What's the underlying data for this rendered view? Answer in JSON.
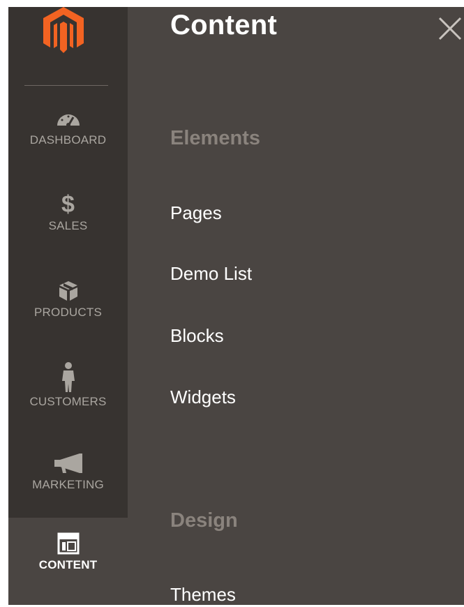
{
  "panel": {
    "title": "Content",
    "close_icon": "close-icon"
  },
  "sidebar": {
    "logo_icon": "magento-logo",
    "items": [
      {
        "label": "DASHBOARD",
        "icon": "speedometer-icon"
      },
      {
        "label": "SALES",
        "icon": "dollar-icon"
      },
      {
        "label": "PRODUCTS",
        "icon": "box-icon"
      },
      {
        "label": "CUSTOMERS",
        "icon": "person-icon"
      },
      {
        "label": "MARKETING",
        "icon": "megaphone-icon"
      },
      {
        "label": "CONTENT",
        "icon": "layout-icon",
        "active": true
      }
    ]
  },
  "sections": [
    {
      "heading": "Elements",
      "links": [
        "Pages",
        "Demo List",
        "Blocks",
        "Widgets"
      ]
    },
    {
      "heading": "Design",
      "links": [
        "Themes"
      ]
    }
  ],
  "colors": {
    "rail_bg": "#373330",
    "panel_bg": "#4a4542",
    "brand_orange": "#f26322",
    "heading_muted": "#8a837d"
  }
}
